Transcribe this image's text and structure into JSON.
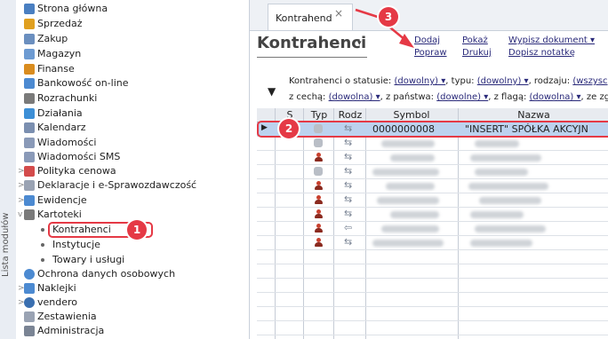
{
  "sidebar": {
    "rail_label": "Lista modułów",
    "items": [
      {
        "label": "Strona główna",
        "icon": "home-icon",
        "color": "#4a7fc1",
        "expand": ""
      },
      {
        "label": "Sprzedaż",
        "icon": "sales-icon",
        "color": "#e0a020",
        "expand": ""
      },
      {
        "label": "Zakup",
        "icon": "purchase-icon",
        "color": "#6b8fbf",
        "expand": ""
      },
      {
        "label": "Magazyn",
        "icon": "warehouse-icon",
        "color": "#6d9bd2",
        "expand": ""
      },
      {
        "label": "Finanse",
        "icon": "finance-icon",
        "color": "#d98c1f",
        "expand": ""
      },
      {
        "label": "Bankowość on-line",
        "icon": "bank-icon",
        "color": "#4c8ad1",
        "expand": ""
      },
      {
        "label": "Rozrachunki",
        "icon": "settlements-icon",
        "color": "#7a7a7a",
        "expand": ""
      },
      {
        "label": "Działania",
        "icon": "actions-icon",
        "color": "#3d8fd6",
        "expand": ""
      },
      {
        "label": "Kalendarz",
        "icon": "calendar-icon",
        "color": "#7b8fb0",
        "expand": ""
      },
      {
        "label": "Wiadomości",
        "icon": "messages-icon",
        "color": "#8a9ab8",
        "expand": ""
      },
      {
        "label": "Wiadomości SMS",
        "icon": "sms-icon",
        "color": "#8a9ab8",
        "expand": ""
      },
      {
        "label": "Polityka cenowa",
        "icon": "pricing-icon",
        "color": "#d34b4b",
        "expand": ">"
      },
      {
        "label": "Deklaracje i e-Sprawozdawczość",
        "icon": "declarations-icon",
        "color": "#9aa3b3",
        "expand": ">"
      },
      {
        "label": "Ewidencje",
        "icon": "records-icon",
        "color": "#4c8ad1",
        "expand": ">"
      },
      {
        "label": "Kartoteki",
        "icon": "catalogs-icon",
        "color": "#7a7a7a",
        "expand": "v"
      }
    ],
    "children": [
      {
        "label": "Kontrahenci"
      },
      {
        "label": "Instytucje"
      },
      {
        "label": "Towary i usługi"
      }
    ],
    "items_after": [
      {
        "label": "Ochrona danych osobowych",
        "icon": "shield-icon",
        "color": "#4c8ad1",
        "expand": ""
      },
      {
        "label": "Naklejki",
        "icon": "labels-icon",
        "color": "#4c8ad1",
        "expand": ">"
      },
      {
        "label": "vendero",
        "icon": "vendero-icon",
        "color": "#3a6fb0",
        "expand": ">"
      },
      {
        "label": "Zestawienia",
        "icon": "reports-icon",
        "color": "#9aa3b3",
        "expand": ""
      },
      {
        "label": "Administracja",
        "icon": "admin-icon",
        "color": "#7a8494",
        "expand": ""
      }
    ]
  },
  "tab": {
    "label": "Kontrahend",
    "close": "×"
  },
  "page": {
    "title": "Kontrahenci",
    "title_caret": "▾"
  },
  "actions": {
    "row1": [
      "Dodaj",
      "Pokaż",
      "Wypisz dokument ▾"
    ],
    "row2": [
      "Popraw",
      "Drukuj",
      "Dopisz notatkę"
    ]
  },
  "filters": {
    "line1_prefix": "Kontrahenci o statusie:",
    "line1_status": "(dowolny) ▾",
    "line1_type_label": ", typu:",
    "line1_type": "(dowolny) ▾",
    "line1_kind_label": ", rodzaju:",
    "line1_kind": "(wszysc",
    "line2_feature_label": "z cechą:",
    "line2_feature": "(dowolna) ▾",
    "line2_country_label": ", z państwa:",
    "line2_country": "(dowolne) ▾",
    "line2_flag_label": ", z flagą:",
    "line2_flag": "(dowolna) ▾",
    "line2_tail": ", ze zgod"
  },
  "grid": {
    "headers": [
      "S",
      "Typ",
      "Rodz",
      "Symbol",
      "Nazwa"
    ],
    "selected_row": {
      "symbol": "0000000008",
      "name": "\"INSERT\" SPÓŁKA AKCYJN"
    },
    "row_pointer": "▶"
  },
  "markers": [
    "1",
    "2",
    "3"
  ],
  "colors": {
    "accent": "#e53945",
    "selection": "#bcd2ee"
  }
}
